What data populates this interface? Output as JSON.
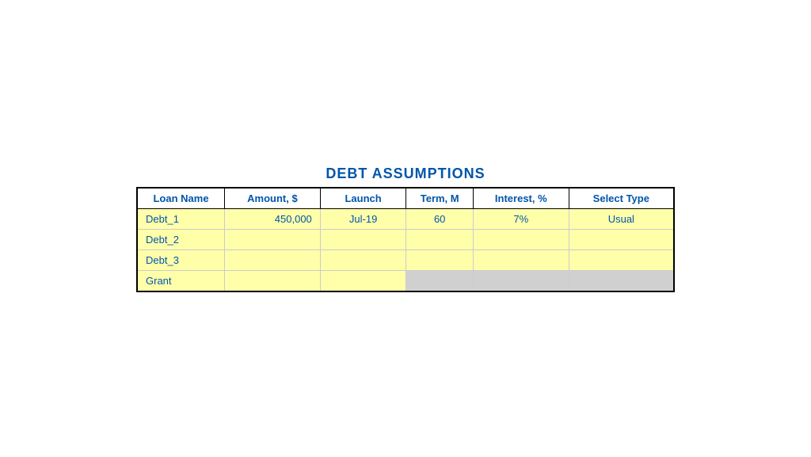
{
  "title": "DEBT ASSUMPTIONS",
  "table": {
    "headers": [
      {
        "label": "Loan Name",
        "key": "loan_name"
      },
      {
        "label": "Amount, $",
        "key": "amount"
      },
      {
        "label": "Launch",
        "key": "launch"
      },
      {
        "label": "Term, M",
        "key": "term"
      },
      {
        "label": "Interest, %",
        "key": "interest"
      },
      {
        "label": "Select Type",
        "key": "select_type"
      }
    ],
    "rows": [
      {
        "loan_name": "Debt_1",
        "amount": "450,000",
        "launch": "Jul-19",
        "term": "60",
        "interest": "7%",
        "select_type": "Usual",
        "term_gray": false,
        "interest_gray": false,
        "type_gray": false
      },
      {
        "loan_name": "Debt_2",
        "amount": "",
        "launch": "",
        "term": "",
        "interest": "",
        "select_type": "",
        "term_gray": false,
        "interest_gray": false,
        "type_gray": false
      },
      {
        "loan_name": "Debt_3",
        "amount": "",
        "launch": "",
        "term": "",
        "interest": "",
        "select_type": "",
        "term_gray": false,
        "interest_gray": false,
        "type_gray": false
      },
      {
        "loan_name": "Grant",
        "amount": "",
        "launch": "",
        "term": "",
        "interest": "",
        "select_type": "",
        "term_gray": true,
        "interest_gray": true,
        "type_gray": true
      }
    ]
  }
}
